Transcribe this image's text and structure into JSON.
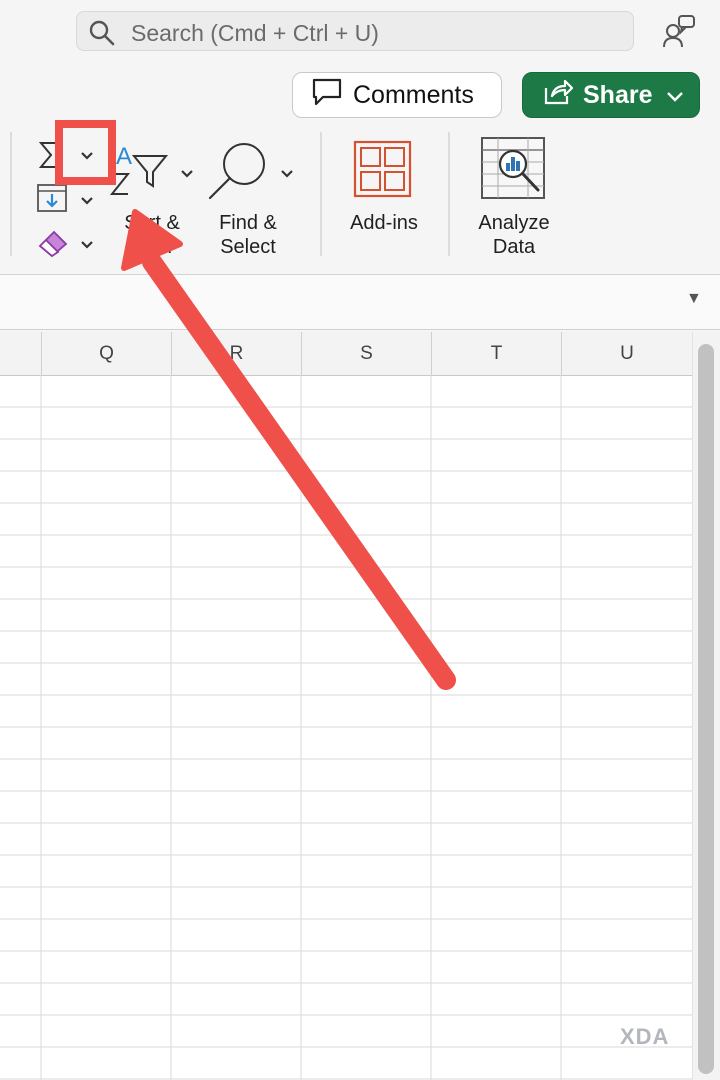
{
  "search": {
    "placeholder": "Search (Cmd + Ctrl + U)"
  },
  "header": {
    "comments_label": "Comments",
    "share_label": "Share"
  },
  "ribbon": {
    "sort_filter_label_line1": "Sort &",
    "sort_filter_label_line2": "Filter",
    "find_select_line1": "Find &",
    "find_select_line2": "Select",
    "addins_label": "Add-ins",
    "analyze_line1": "Analyze",
    "analyze_line2": "Data"
  },
  "columns": [
    "Q",
    "R",
    "S",
    "T",
    "U"
  ],
  "watermark": "XDA",
  "colors": {
    "share_green": "#1d7a46",
    "annotation_red": "#f0504a",
    "addins_orange": "#d35230",
    "analyze_blue": "#2e75b6",
    "clear_purple": "#b255c9",
    "autosum_blue": "#2a8ad4"
  },
  "icons": [
    "search-icon",
    "coauthor-icon",
    "comment-icon",
    "share-icon",
    "chevron-down-icon",
    "autosum-icon",
    "fill-icon",
    "clear-eraser-icon",
    "sort-az-icon",
    "filter-funnel-icon",
    "magnifier-icon",
    "addins-grid-icon",
    "analyze-data-icon"
  ]
}
